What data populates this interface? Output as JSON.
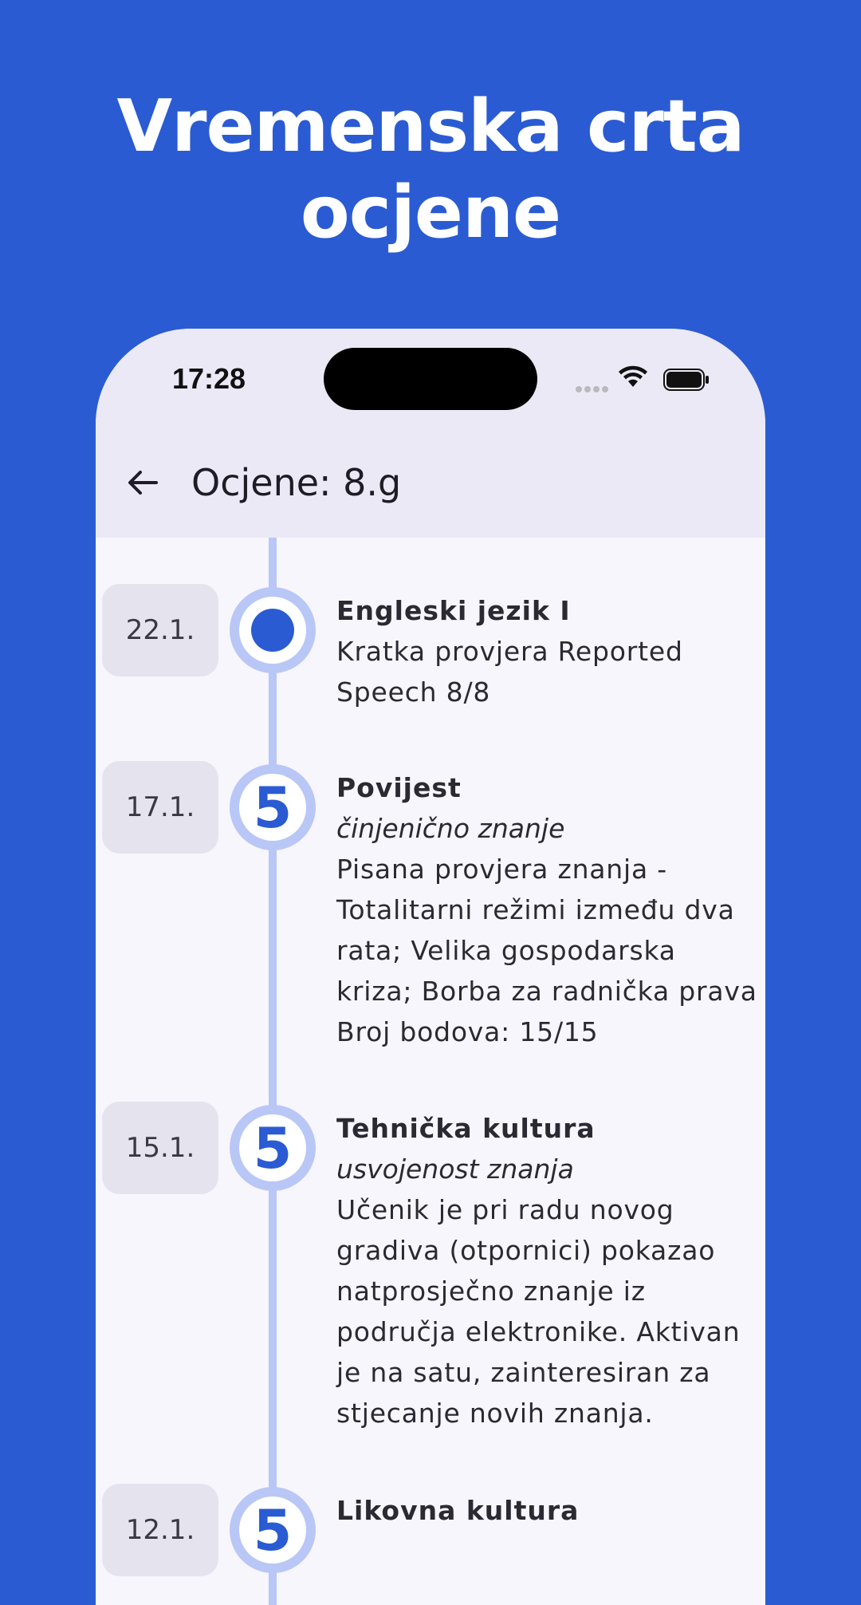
{
  "promo": {
    "title_line1": "Vremenska crta",
    "title_line2": "ocjene"
  },
  "status_bar": {
    "time": "17:28"
  },
  "appbar": {
    "title": "Ocjene: 8.g"
  },
  "colors": {
    "background": "#2a5bd3",
    "accent": "#2a5bd3",
    "timeline": "#b9c7f7"
  },
  "timeline": [
    {
      "date": "22.1.",
      "grade": "",
      "subject": "Engleski jezik I",
      "category": "",
      "description": "Kratka provjera Reported Speech 8/8"
    },
    {
      "date": "17.1.",
      "grade": "5",
      "subject": "Povijest",
      "category": "činjenično znanje",
      "description": "Pisana provjera znanja - Totalitarni režimi između dva rata; Velika gospodarska kriza; Borba za radnička prava Broj bodova: 15/15"
    },
    {
      "date": "15.1.",
      "grade": "5",
      "subject": "Tehnička kultura",
      "category": "usvojenost znanja",
      "description": "Učenik je pri radu novog gradiva (otpornici) pokazao natprosječno znanje iz područja elektronike. Aktivan je na satu, zainteresiran za stjecanje novih znanja."
    },
    {
      "date": "12.1.",
      "grade": "5",
      "subject": "Likovna kultura",
      "category": "",
      "description": ""
    }
  ]
}
